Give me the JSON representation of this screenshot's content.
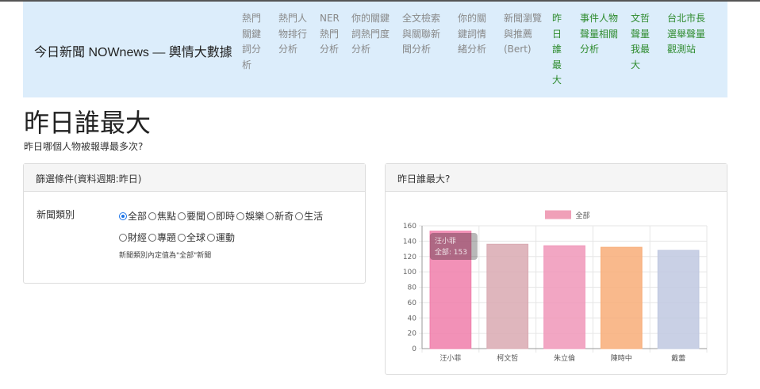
{
  "navbar": {
    "brand": "今日新聞 NOWnews — 輿情大數據",
    "items": [
      {
        "label": "熱門關鍵詞分析",
        "active": false
      },
      {
        "label": "熱門人物排行分析",
        "active": false
      },
      {
        "label": "NER熱門分析",
        "active": false
      },
      {
        "label": "你的關鍵詞熱門度分析",
        "active": false
      },
      {
        "label": "全文檢索與關聯新聞分析",
        "active": false
      },
      {
        "label": "你的關鍵詞情緒分析",
        "active": false
      },
      {
        "label": "新聞瀏覽與推薦(Bert)",
        "active": false
      },
      {
        "label": "昨日誰最大",
        "active": true
      },
      {
        "label": "事件人物聲量相關分析",
        "active": true
      },
      {
        "label": "文哲聲量我最大",
        "active": true
      },
      {
        "label": "台北市長選舉聲量觀測站",
        "active": true
      }
    ]
  },
  "page": {
    "title": "昨日誰最大",
    "subtitle": "昨日哪個人物被報導最多次?"
  },
  "filter_panel": {
    "heading": "篩選條件(資料週期:昨日)",
    "label": "新聞類別",
    "options": [
      {
        "label": "全部",
        "checked": true
      },
      {
        "label": "焦點",
        "checked": false
      },
      {
        "label": "要聞",
        "checked": false
      },
      {
        "label": "即時",
        "checked": false
      },
      {
        "label": "娛樂",
        "checked": false
      },
      {
        "label": "新奇",
        "checked": false
      },
      {
        "label": "生活",
        "checked": false
      },
      {
        "label": "財經",
        "checked": false
      },
      {
        "label": "專題",
        "checked": false
      },
      {
        "label": "全球",
        "checked": false
      },
      {
        "label": "運動",
        "checked": false
      }
    ],
    "hint": "新聞類別內定值為\"全部\"新聞"
  },
  "chart_panel": {
    "heading": "昨日誰最大?"
  },
  "chart_data": {
    "type": "bar",
    "categories": [
      "汪小菲",
      "柯文哲",
      "朱立倫",
      "陳時中",
      "戴蕾"
    ],
    "series": [
      {
        "name": "全部",
        "values": [
          153,
          136,
          134,
          132,
          128
        ]
      }
    ],
    "bar_colors": [
      "#f07eaa",
      "#d9a9b2",
      "#f097b9",
      "#f8ad78",
      "#c0c8e0"
    ],
    "legend_color": "#f0a0b8",
    "ylim": [
      0,
      160
    ],
    "yticks": [
      0,
      20,
      40,
      60,
      80,
      100,
      120,
      140,
      160
    ],
    "legend": "top",
    "grid": true,
    "tooltip": {
      "title": "汪小菲",
      "body": "全部: 153"
    }
  }
}
